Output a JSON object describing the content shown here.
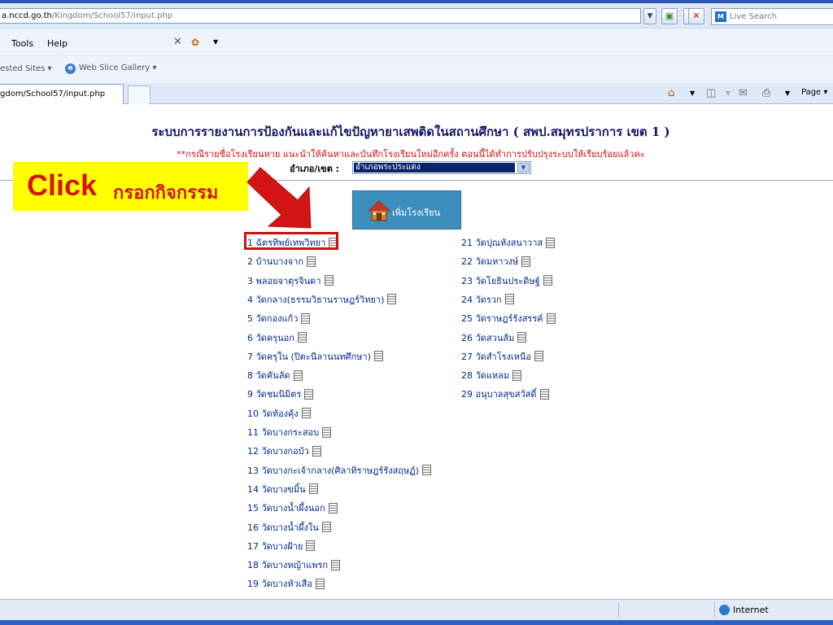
{
  "browser": {
    "address_domain": "a.nccd.go.th",
    "address_path": "/Kingdom/School57/input.php",
    "search_placeholder": "Live Search",
    "live_logo_text": "M",
    "menu": {
      "tools": "Tools",
      "help": "Help"
    },
    "favorites": {
      "suggested": "ested Sites",
      "gallery": "Web Slice Gallery"
    },
    "tab_title": "gdom/School57/input.php",
    "page_menu": "Page"
  },
  "page": {
    "title": "ระบบการรายงานการป้องกันและแก้ไขปัญหายาเสพติดในสถานศึกษา ( สพป.สมุทรปราการ เขต 1 )",
    "notice": "**กรณีรายชื่อโรงเรียนหาย แนะนำให้ค้นหาและบันทึกโรงเรียนใหม่อีกครั้ง ตอนนี้ได้ทำการปรับปรุงระบบให้เรียบร้อยแล้วคะ",
    "district_label": "อำเภอ/เขต :",
    "district_value": "อำเภอพระประแดง",
    "add_school_label": "เพิ่มโรงเรียน",
    "schools_left": [
      "1 ฉัตรทิพย์เทพวิทยา",
      "2 บ้านบางจาก",
      "3 พลอยจาตุรจินดา",
      "4 วัดกลาง(ธรรมวิธานราษฎร์วิทยา)",
      "5 วัดกองแก้ว",
      "6 วัดครุนอก",
      "7 วัดครุใน (ปิตะนีลานนทศึกษา)",
      "8 วัดคันลัด",
      "9 วัดชมนิมิตร",
      "10 วัดท้องคุ้ง",
      "11 วัดบางกระสอบ",
      "12 วัดบางกอบัว",
      "13 วัดบางกะเจ้ากลาง(ศิลาทิราษฎร์รังสฤษฏ์)",
      "14 วัดบางขมิ้น",
      "15 วัดบางน้ำผึ้งนอก",
      "16 วัดบางน้ำผึ้งใน",
      "17 วัดบางฝ้าย",
      "18 วัดบางหญ้าแพรก",
      "19 วัดบางหัวเสือ"
    ],
    "schools_right": [
      "21 วัดปุณหังสนาวาส",
      "22 วัดมหาวงษ์",
      "23 วัดโยธินประดิษฐ์",
      "24 วัดรวก",
      "25 วัดราษฎร์รังสรรค์",
      "26 วัดสวนส้ม",
      "27 วัดสำโรงเหนือ",
      "28 วัดแหลม",
      "29 อนุบาลสุขสวัสดิ์"
    ]
  },
  "annotation": {
    "click_en": "Click",
    "click_th": "กรอกกิจกรรม",
    "callout_bg": "#ffff00",
    "accent_red": "#d21414"
  },
  "status": {
    "zone": "Internet"
  },
  "icons": {
    "memo": "memo-icon",
    "house": "house-icon",
    "globe": "globe-icon"
  }
}
